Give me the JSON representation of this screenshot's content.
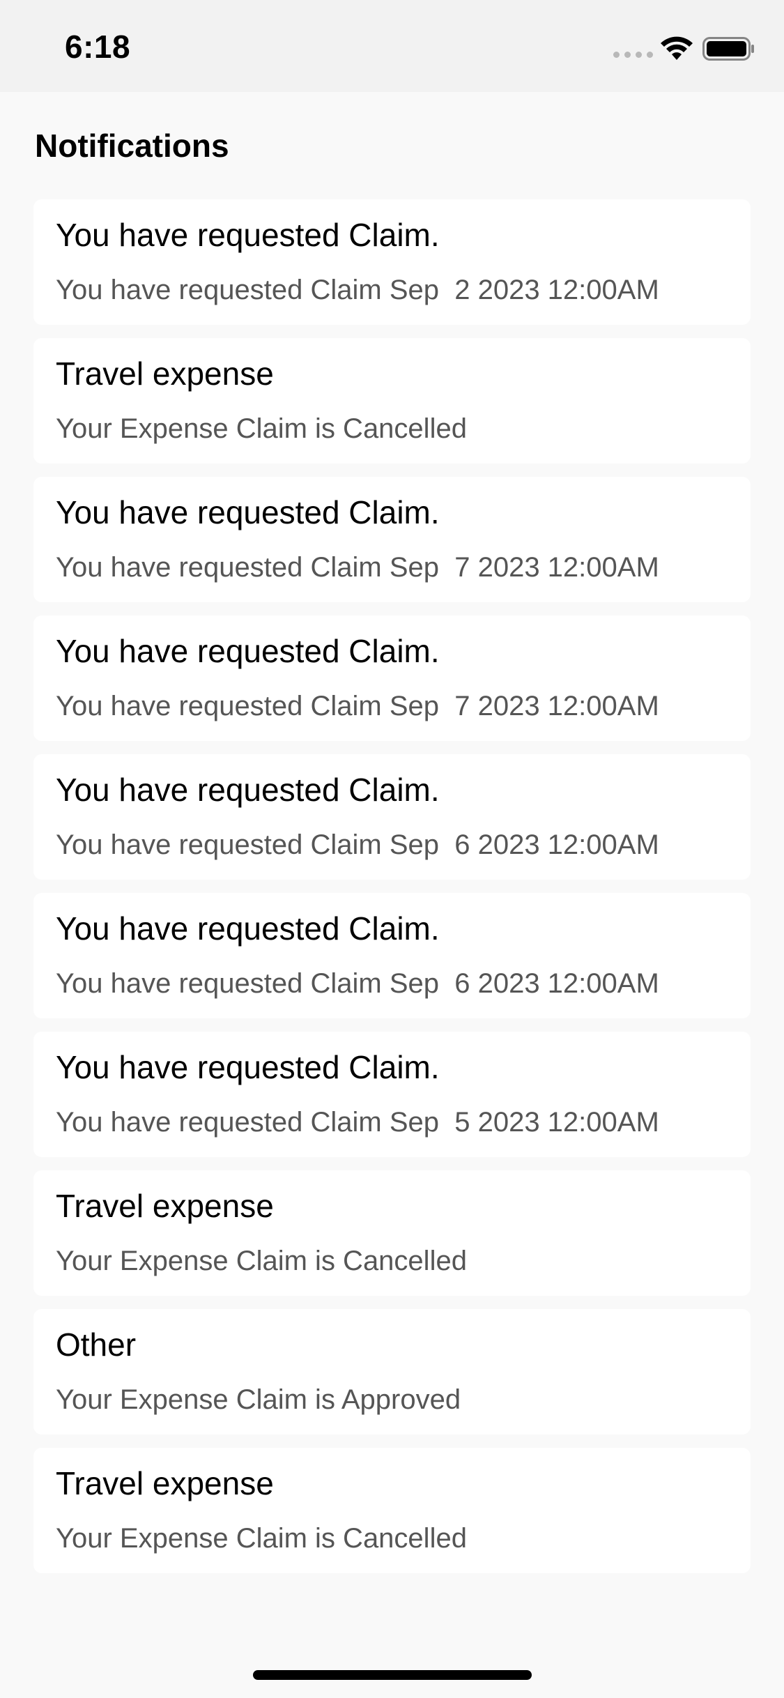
{
  "status_bar": {
    "time": "6:18"
  },
  "header": {
    "title": "Notifications"
  },
  "notifications": [
    {
      "title": "You have requested Claim.",
      "body": "You have requested Claim Sep  2 2023 12:00AM"
    },
    {
      "title": "Travel expense",
      "body": "Your Expense Claim is Cancelled"
    },
    {
      "title": "You have requested Claim.",
      "body": "You have requested Claim Sep  7 2023 12:00AM"
    },
    {
      "title": "You have requested Claim.",
      "body": "You have requested Claim Sep  7 2023 12:00AM"
    },
    {
      "title": "You have requested Claim.",
      "body": "You have requested Claim Sep  6 2023 12:00AM"
    },
    {
      "title": "You have requested Claim.",
      "body": "You have requested Claim Sep  6 2023 12:00AM"
    },
    {
      "title": "You have requested Claim.",
      "body": "You have requested Claim Sep  5 2023 12:00AM"
    },
    {
      "title": "Travel expense",
      "body": "Your Expense Claim is Cancelled"
    },
    {
      "title": "Other",
      "body": "Your Expense Claim is Approved"
    },
    {
      "title": "Travel expense",
      "body": "Your Expense Claim is Cancelled"
    }
  ],
  "icons": {
    "signal": "cellular-signal-icon",
    "wifi": "wifi-icon",
    "battery": "battery-icon"
  },
  "colors": {
    "background": "#f9f9f9",
    "status_bar": "#f2f2f2",
    "card": "#ffffff",
    "secondary_text": "#555555"
  }
}
